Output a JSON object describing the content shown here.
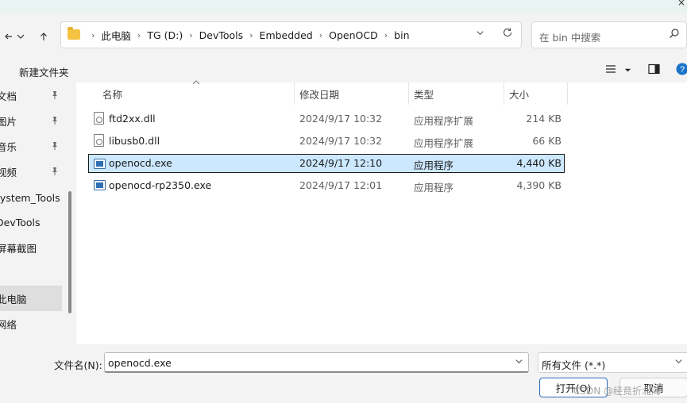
{
  "window": {
    "close_glyph": "×"
  },
  "nav": {
    "back_icon": "arrow-left-icon",
    "recent_icon": "chevron-down-icon",
    "up_icon": "arrow-up-icon"
  },
  "address": {
    "crumbs": [
      "此电脑",
      "TG (D:)",
      "DevTools",
      "Embedded",
      "OpenOCD",
      "bin"
    ],
    "refresh_icon": "refresh-icon"
  },
  "search": {
    "placeholder": "在 bin 中搜索",
    "icon": "search-icon"
  },
  "toolbar": {
    "new_folder": "新建文件夹",
    "view_icon": "list-view-icon",
    "preview_icon": "preview-pane-icon",
    "help_icon": "help-icon",
    "help_glyph": "?"
  },
  "sidebar": {
    "items": [
      {
        "label": "文档",
        "pinned": true
      },
      {
        "label": "图片",
        "pinned": true
      },
      {
        "label": "音乐",
        "pinned": true
      },
      {
        "label": "视频",
        "pinned": true
      },
      {
        "label": "System_Tools",
        "pinned": false
      },
      {
        "label": "DevTools",
        "pinned": false
      },
      {
        "label": "屏幕截图",
        "pinned": false
      },
      {
        "label": "此电脑",
        "pinned": false,
        "selected": true
      },
      {
        "label": "网络",
        "pinned": false
      }
    ]
  },
  "table": {
    "columns": {
      "name": "名称",
      "modified": "修改日期",
      "type": "类型",
      "size": "大小"
    },
    "rows": [
      {
        "name": "ftd2xx.dll",
        "modified": "2024/9/17 10:32",
        "type": "应用程序扩展",
        "size": "214 KB",
        "icon": "dll-file-icon"
      },
      {
        "name": "libusb0.dll",
        "modified": "2024/9/17 10:32",
        "type": "应用程序扩展",
        "size": "66 KB",
        "icon": "dll-file-icon"
      },
      {
        "name": "openocd.exe",
        "modified": "2024/9/17 12:10",
        "type": "应用程序",
        "size": "4,440 KB",
        "icon": "exe-file-icon",
        "selected": true
      },
      {
        "name": "openocd-rp2350.exe",
        "modified": "2024/9/17 12:01",
        "type": "应用程序",
        "size": "4,390 KB",
        "icon": "exe-file-icon"
      }
    ]
  },
  "footer": {
    "filename_label": "文件名(N):",
    "filename_value": "openocd.exe",
    "filetype_value": "所有文件 (*.*)",
    "open_label": "打开(O)",
    "cancel_label": "取消",
    "watermark": "CSDN @经竟折北海"
  }
}
